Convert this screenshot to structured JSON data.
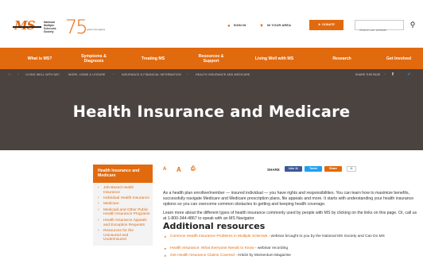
{
  "header": {
    "logo_text": "MS",
    "org_name": "National Multiple Sclerosis Society",
    "anniversary_number": "75",
    "anniversary_tagline": "years of progress",
    "sign_in": "SIGN IN",
    "in_your_area": "IN YOUR AREA",
    "donate": "DONATE",
    "search_placeholder": "Search our website"
  },
  "nav": {
    "items": [
      {
        "label": "What is MS?"
      },
      {
        "label": "Symptoms &\nDiagnosis"
      },
      {
        "label": "Treating MS"
      },
      {
        "label": "Resources &\nSupport"
      },
      {
        "label": "Living Well with MS"
      },
      {
        "label": "Research"
      },
      {
        "label": "Get Involved"
      }
    ]
  },
  "breadcrumb": {
    "items": [
      "LIVING WELL WITH MS",
      "WORK, HOME & LEISURE",
      "INSURANCE & FINANCIAL INFORMATION",
      "HEALTH INSURANCE AND MEDICARE"
    ],
    "share_label": "SHARE THIS PAGE"
  },
  "page": {
    "title": "Health Insurance and Medicare"
  },
  "sidebar": {
    "heading": "Health Insurance and Medicare",
    "items": [
      {
        "label": "Job-Based Health Insurance"
      },
      {
        "label": "Individual Health Insurance"
      },
      {
        "label": "Medicare"
      },
      {
        "label": "Medicaid and Other Public Health Insurance Programs"
      },
      {
        "label": "Health Insurance Appeals and Exception Requests"
      },
      {
        "label": "Resources for the Uninsured and Underinsured"
      }
    ]
  },
  "content": {
    "share_label": "SHARE",
    "like_label": "Like 11",
    "tweet_label": "Tweet",
    "share_btn_label": "Share",
    "share_count": "11",
    "paragraph1": "As a health plan enrollee/member — insured individual — you have rights and responsibilities. You can learn how to maximize benefits, successfully navigate Medicare and Medicare prescription plans, file appeals and more. It starts with understanding your health insurance options so you can overcome common obstacles to getting and keeping health coverage.",
    "paragraph2": "Learn more about the different types of health insurance commonly used by people with MS by clicking on the links on this page. Or, call us at 1-800-344-4867 to speak with an MS Navigator.",
    "resources_heading": "Additional resources",
    "resources": [
      {
        "link": "Common Health Insurance Problems in Multiple Sclerosis",
        "rest": " - webinar brought to you by the National MS Society and Can Do MS"
      },
      {
        "link": "Health Insurance: What Everyone Needs to Know",
        "rest": " - webinar recording"
      },
      {
        "link": "Get Health Insurance Claims Covered",
        "rest": " - Article by Momentum Magazine"
      }
    ]
  },
  "colors": {
    "brand_orange": "#e26a0e",
    "dark_band": "#4a4340",
    "facebook_blue": "#3b5998",
    "twitter_blue": "#1da1f2"
  },
  "icons": [
    "person-icon",
    "location-pin-icon",
    "donate-icon",
    "search-icon",
    "home-icon",
    "facebook-icon",
    "twitter-icon",
    "email-icon",
    "font-size-small-icon",
    "font-size-large-icon",
    "print-icon"
  ]
}
